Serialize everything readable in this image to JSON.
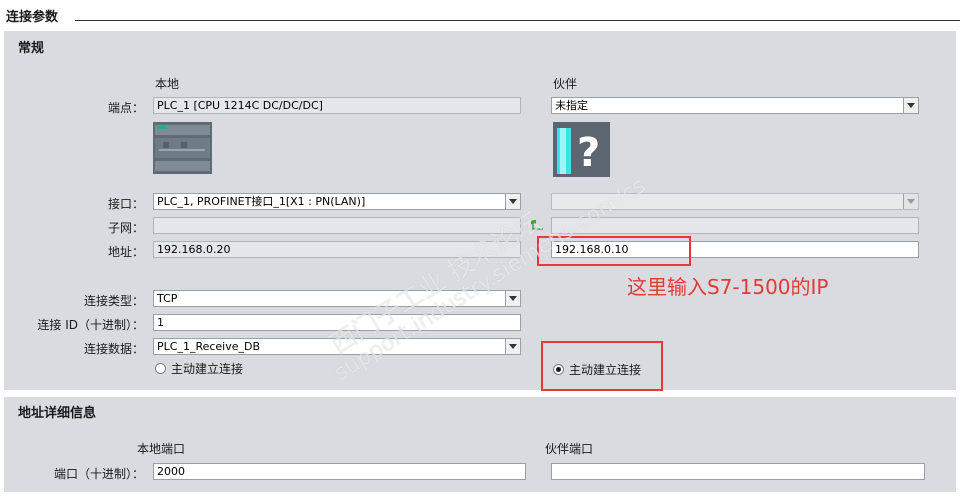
{
  "header": {
    "title": "连接参数"
  },
  "general": {
    "title": "常规",
    "local_heading": "本地",
    "partner_heading": "伙伴",
    "rows": {
      "endpoint_label": "端点：",
      "interface_label": "接口：",
      "subnet_label": "子网：",
      "address_label": "地址：",
      "conn_type_label": "连接类型：",
      "conn_id_label": "连接 ID（十进制）：",
      "conn_data_label": "连接数据：",
      "active_label_local": "主动建立连接",
      "active_label_partner": "主动建立连接"
    },
    "local": {
      "endpoint": "PLC_1 [CPU 1214C DC/DC/DC]",
      "interface": "PLC_1, PROFINET接口_1[X1 : PN(LAN)]",
      "subnet": "",
      "address": "192.168.0.20",
      "conn_type": "TCP",
      "conn_id": "1",
      "conn_data": "PLC_1_Receive_DB",
      "active": false
    },
    "partner": {
      "endpoint": "未指定",
      "interface": "",
      "subnet": "",
      "address": "192.168.0.10",
      "active": true
    },
    "annotation": "这里输入S7-1500的IP"
  },
  "address_details": {
    "title": "地址详细信息",
    "local_port_heading": "本地端口",
    "partner_port_heading": "伙伴端口",
    "port_label": "端口（十进制）：",
    "local_port": "2000",
    "partner_port": ""
  },
  "watermark": {
    "line1": "西门子工业 技术论坛",
    "line2": "support.industry.siemens.com/cs"
  },
  "colors": {
    "annotation_red": "#e53935",
    "panel_bg": "#d9dbe0",
    "link_green": "#3aa635"
  }
}
